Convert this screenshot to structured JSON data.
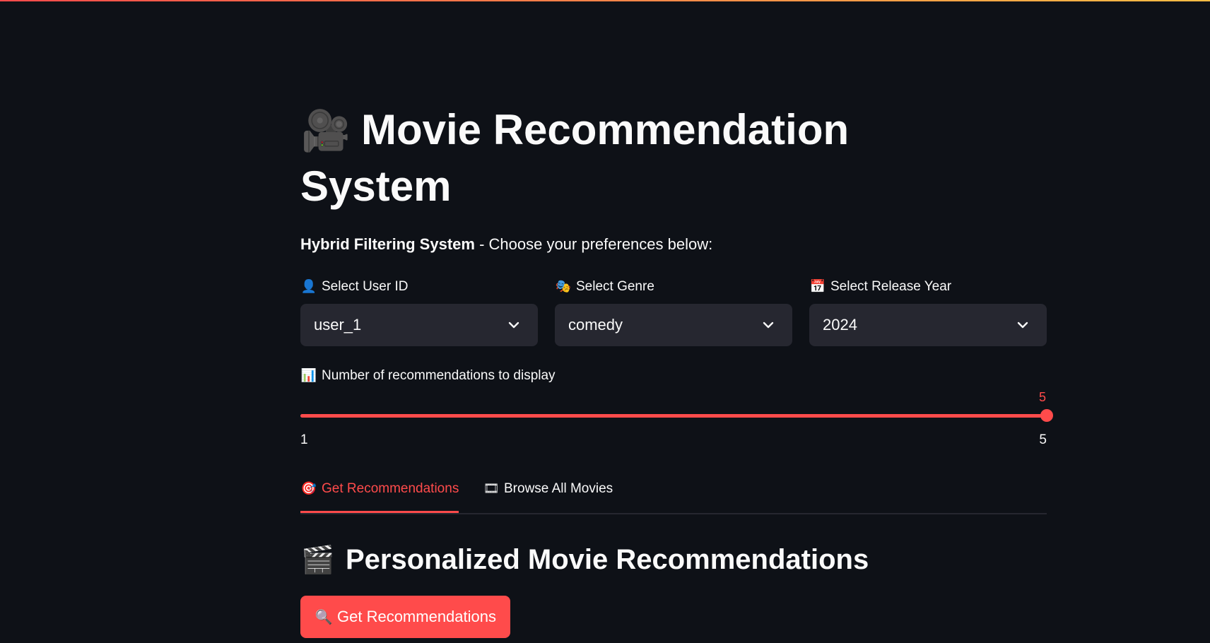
{
  "header": {
    "title_icon": "movie-camera-icon",
    "title_emoji": "🎥",
    "title": "Movie Recommendation System",
    "subtitle_bold": "Hybrid Filtering System",
    "subtitle_rest": " - Choose your preferences below:"
  },
  "filters": {
    "user": {
      "icon": "user-silhouette-icon",
      "emoji": "👤",
      "label": "Select User ID",
      "value": "user_1"
    },
    "genre": {
      "icon": "theater-masks-icon",
      "emoji": "🎭",
      "label": "Select Genre",
      "value": "comedy"
    },
    "year": {
      "icon": "calendar-icon",
      "emoji": "📅",
      "label": "Select Release Year",
      "value": "2024"
    }
  },
  "slider": {
    "icon": "bar-chart-icon",
    "emoji": "📊",
    "label": "Number of recommendations to display",
    "value": 5,
    "min": 1,
    "max": 5,
    "value_label": "5",
    "min_label": "1",
    "max_label": "5"
  },
  "tabs": [
    {
      "icon": "direct-hit-icon",
      "emoji": "🎯",
      "label": "Get Recommendations",
      "active": true
    },
    {
      "icon": "film-strip-icon",
      "emoji": "🎞",
      "label": "Browse All Movies",
      "active": false
    }
  ],
  "section": {
    "icon": "clapper-board-icon",
    "emoji": "🎬",
    "heading": "Personalized Movie Recommendations"
  },
  "action_button": {
    "icon": "magnifier-icon",
    "emoji": "🔍",
    "label": "Get Recommendations"
  },
  "colors": {
    "background": "#0e1117",
    "input_background": "#262730",
    "accent": "#ff4b4b",
    "text": "#fafafa"
  }
}
